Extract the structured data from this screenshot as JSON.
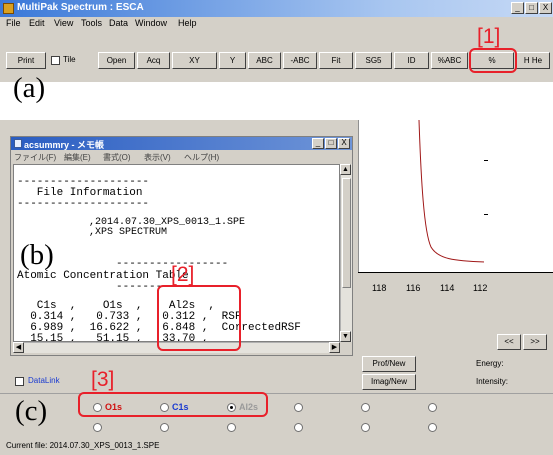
{
  "window": {
    "title": "MultiPak Spectrum : ESCA",
    "controls": [
      "_",
      "□",
      "X"
    ]
  },
  "menu": [
    "File",
    "Edit",
    "View",
    "Tools",
    "Data",
    "Window",
    "Help"
  ],
  "toolbar": {
    "print": "Print",
    "tile": "Tile",
    "open": "Open",
    "acq": "Acq",
    "xy": "XY",
    "y": "Y",
    "abc": "ABC",
    "neg_abc": "-ABC",
    "fit": "Fit",
    "sg5": "SG5",
    "id": "ID",
    "pct_abc": "%ABC",
    "pct": "%",
    "hhe": "H He"
  },
  "annotations": {
    "a": "(a)",
    "b": "(b)",
    "c": "(c)",
    "m1": "[1]",
    "m2": "[2]",
    "m3": "[3]"
  },
  "notepad": {
    "title": "acsummry - メモ帳",
    "controls": [
      "_",
      "□",
      "X"
    ],
    "menu": [
      "ファイル(F)",
      "編集(E)",
      "書式(O)",
      "表示(V)",
      "ヘルプ(H)"
    ],
    "lines": [
      "--------------------",
      "   File Information",
      "--------------------",
      "",
      "            ,2014.07.30_XPS_0013_1.SPE",
      "            ,XPS SPECTRUM",
      "",
      "               -----------------",
      "Atomic Concentration Table",
      "               -----------------",
      "",
      "   C1s  ,    O1s  ,    Al2s  ,",
      "  0.314 ,   0.733 ,   0.312 ,  RSF",
      "  6.989 ,  16.622 ,   6.848 ,  CorrectedRSF",
      "  15.15 ,   51.15 ,   33.70 ,"
    ]
  },
  "spectrum": {
    "ticks": [
      "118",
      "116",
      "114",
      "112"
    ],
    "color": "#a01818"
  },
  "side": {
    "prev": "<<",
    "next": ">>",
    "energy": "Energy:",
    "intensity": "Intensity:",
    "prof_new": "Prof/New",
    "imag_new": "Imag/New",
    "datalink": "DataLink"
  },
  "regions": {
    "row1": [
      {
        "label": "O1s",
        "color": "#d01010",
        "selected": false
      },
      {
        "label": "C1s",
        "color": "#1a3ad0",
        "selected": false
      },
      {
        "label": "Al2s",
        "color": "#9a9a9a",
        "selected": true
      },
      {
        "label": "",
        "color": "#000000",
        "selected": false
      },
      {
        "label": "",
        "color": "#000000",
        "selected": false
      },
      {
        "label": "",
        "color": "#000000",
        "selected": false
      }
    ],
    "row2_count": 6
  },
  "status": {
    "current_file": "Current file: 2014.07.30_XPS_0013_1.SPE"
  },
  "accent": "#e8202a"
}
